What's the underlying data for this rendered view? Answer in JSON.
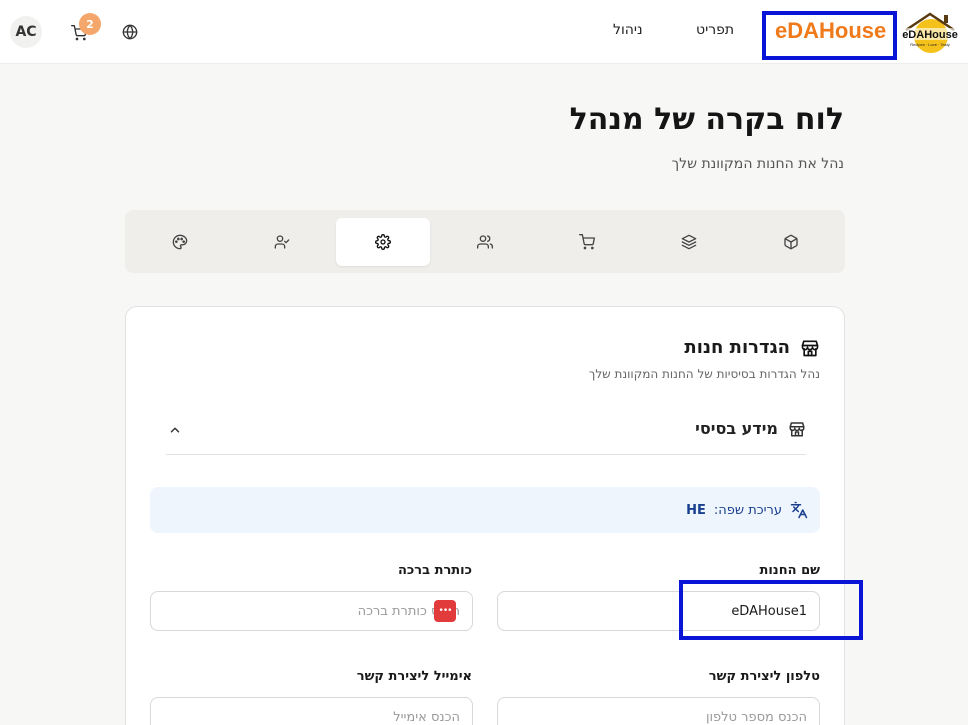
{
  "header": {
    "avatar_initials": "AC",
    "cart_count": "2",
    "nav": {
      "manage": "ניהול",
      "menu": "תפריט"
    },
    "brand": "eDAHouse",
    "logo_text": "eDAHouse",
    "logo_tagline": "Recipes · Love · Tasty"
  },
  "page": {
    "title": "לוח בקרה של מנהל",
    "subtitle": "נהל את החנות המקוונת שלך"
  },
  "tabs": [
    {
      "icon": "palette-icon"
    },
    {
      "icon": "user-check-icon"
    },
    {
      "icon": "settings-gear-icon",
      "active": true
    },
    {
      "icon": "users-icon"
    },
    {
      "icon": "shopping-cart-icon"
    },
    {
      "icon": "layers-icon"
    },
    {
      "icon": "package-icon"
    }
  ],
  "card": {
    "title": "הגדרות חנות",
    "subtitle": "נהל הגדרות בסיסיות של החנות המקוונת שלך",
    "section_title": "מידע בסיסי",
    "lang_label": "עריכת שפה:",
    "lang_code": "HE"
  },
  "fields": {
    "store_name": {
      "label": "שם החנות",
      "value": "eDAHouse1"
    },
    "welcome_title": {
      "label": "כותרת ברכה",
      "placeholder": "הכנס כותרת ברכה"
    },
    "phone": {
      "label": "טלפון ליצירת קשר",
      "placeholder": "הכנס מספר טלפון"
    },
    "email": {
      "label": "אימייל ליצירת קשר",
      "placeholder": "הכנס אימייל"
    }
  },
  "colors": {
    "accent_orange": "#f07a1a",
    "highlight_blue": "#0a14d6",
    "badge": "#f5a66b"
  }
}
